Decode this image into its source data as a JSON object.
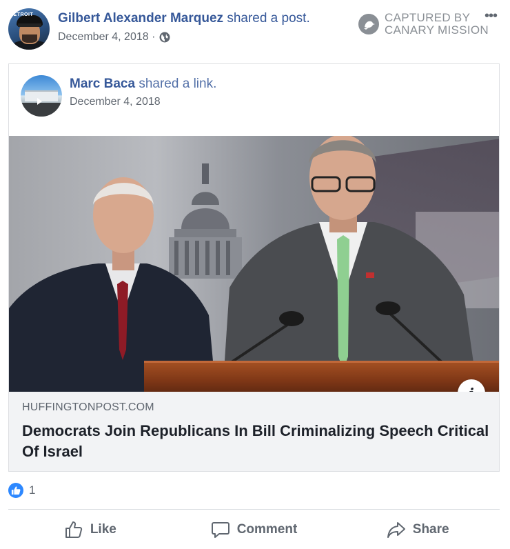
{
  "post": {
    "author": "Gilbert Alexander Marquez",
    "action": "shared a post.",
    "date": "December 4, 2018 ·",
    "privacy_icon": "globe-icon",
    "avatar_label": "DETROIT"
  },
  "watermark": {
    "line1": "CAPTURED BY",
    "line2": "CANARY MISSION",
    "icon": "canary-bird-icon"
  },
  "shared": {
    "author": "Marc Baca",
    "action": "shared a link.",
    "date": "December 4, 2018"
  },
  "article": {
    "image_description_icon": "info-icon",
    "info_label": "i",
    "domain": "HUFFINGTONPOST.COM",
    "title": "Democrats Join Republicans In Bill Criminalizing Speech Critical Of Israel"
  },
  "reactions": {
    "count": "1",
    "icon": "like-reaction-icon"
  },
  "actions": {
    "like": "Like",
    "comment": "Comment",
    "share": "Share"
  },
  "colors": {
    "link_blue": "#365899",
    "like_blue": "#2d88ff",
    "secondary_text": "#606770",
    "caption_bg": "#f2f3f5"
  }
}
